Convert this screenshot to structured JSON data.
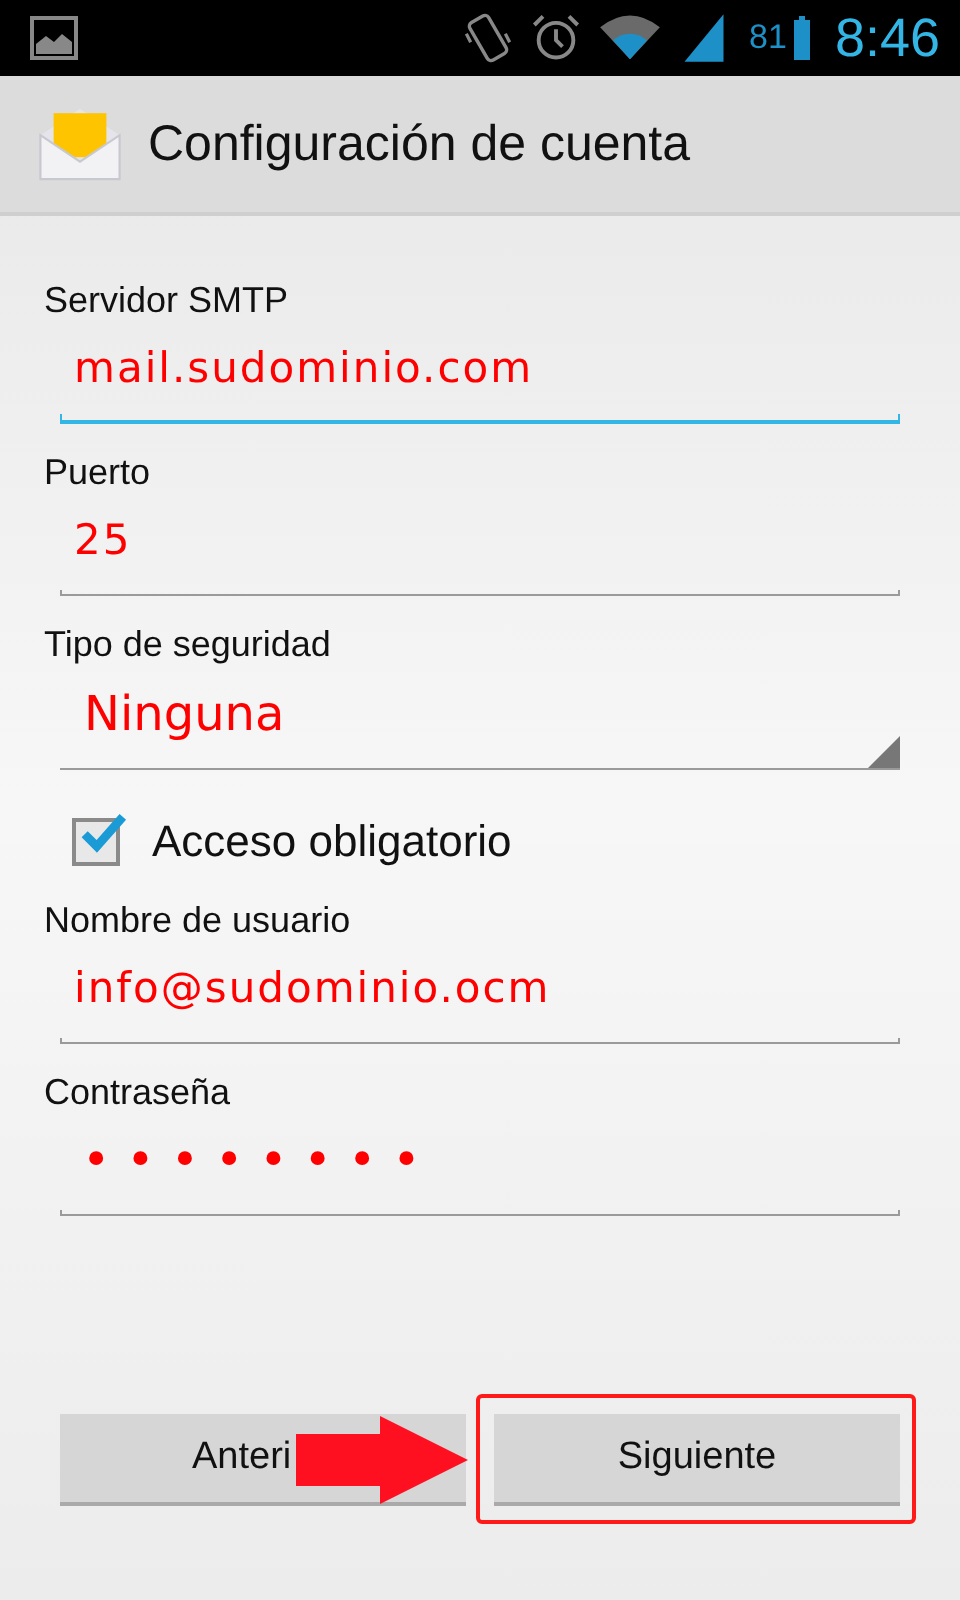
{
  "status_bar": {
    "battery": "81",
    "time": "8:46"
  },
  "action_bar": {
    "title": "Configuración de cuenta"
  },
  "fields": [
    {
      "kind": "text",
      "label": "Servidor SMTP",
      "value": "mail.sudominio.com",
      "focused": true
    },
    {
      "kind": "text",
      "label": "Puerto",
      "value": "25",
      "focused": false
    },
    {
      "kind": "dropdown",
      "label": "Tipo de seguridad",
      "value": "Ninguna"
    },
    {
      "kind": "checkbox",
      "label": "Acceso obligatorio",
      "checked": true
    },
    {
      "kind": "text",
      "label": "Nombre de usuario",
      "value": "info@sudominio.ocm",
      "focused": false
    },
    {
      "kind": "password",
      "label": "Contraseña",
      "value": "••••••••",
      "focused": false
    }
  ],
  "buttons": [
    {
      "label": "Anteri"
    },
    {
      "label": "Siguiente"
    }
  ]
}
